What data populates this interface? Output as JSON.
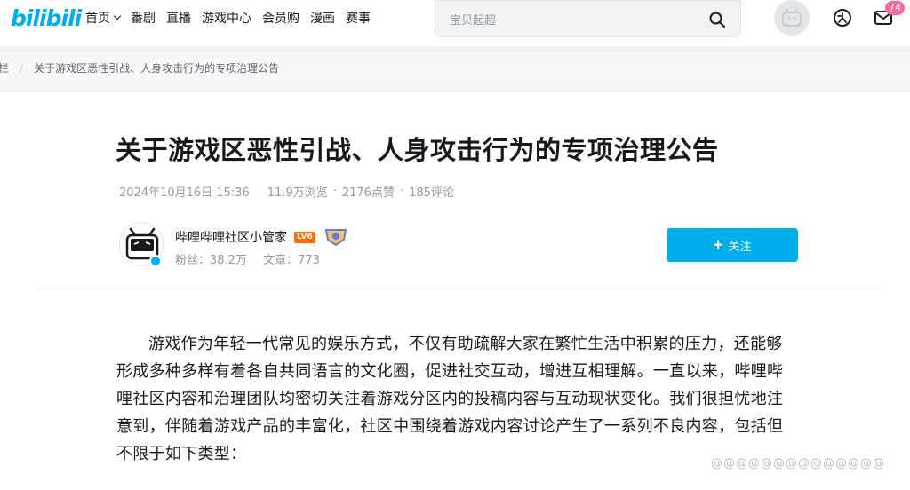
{
  "header": {
    "logo": "bilibili",
    "nav": [
      "首页",
      "番剧",
      "直播",
      "游戏中心",
      "会员购",
      "漫画",
      "赛事"
    ],
    "search_placeholder": "宝贝起超",
    "message_count": "74"
  },
  "breadcrumb": [
    "专栏",
    "关于游戏区恶性引战、人身攻击行为的专项治理公告"
  ],
  "article": {
    "title": "关于游戏区恶性引战、人身攻击行为的专项治理公告",
    "date": "2024年10月16日 15:36",
    "views": "11.9万浏览",
    "likes": "2176点赞",
    "comments": "185评论",
    "body": "游戏作为年轻一代常见的娱乐方式，不仅有助疏解大家在繁忙生活中积累的压力，还能够形成多种多样有着各自共同语言的文化圈，促进社交互动，增进互相理解。一直以来，哔哩哔哩社区内容和治理团队均密切关注着游戏分区内的投稿内容与互动现状变化。我们很担忧地注意到，伴随着游戏产品的丰富化，社区中围绕着游戏内容讨论产生了一系列不良内容，包括但不限于如下类型："
  },
  "author": {
    "name": "哔哩哔哩社区小管家",
    "level": "LV6",
    "fans": "粉丝：38.2万",
    "articles": "文章：773",
    "follow_label": "关注"
  },
  "watermark": "@@@@@@@@@@@@@@",
  "colors": {
    "accent": "#00aeec",
    "badge": "#ff6699",
    "level": "#ff6c00"
  }
}
